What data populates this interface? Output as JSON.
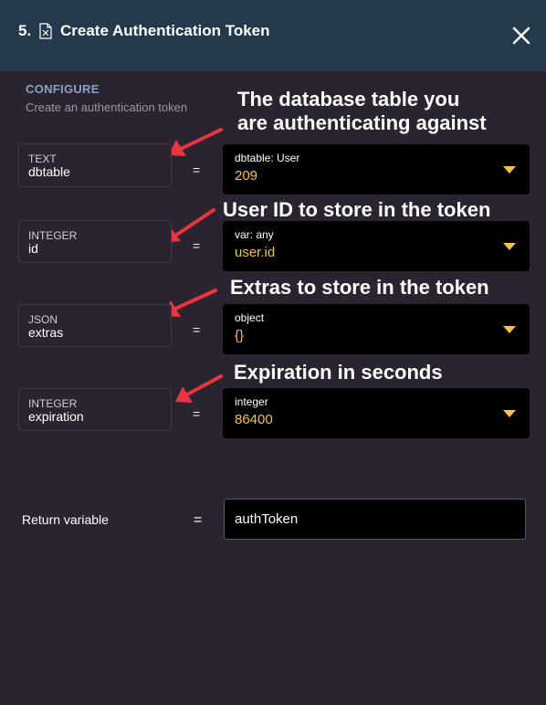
{
  "header": {
    "step": "5.",
    "title": "Create Authentication Token"
  },
  "section": {
    "title": "CONFIGURE",
    "subtitle": "Create an authentication token"
  },
  "params": [
    {
      "type": "TEXT",
      "name": "dbtable",
      "equals": "=",
      "value_type": "dbtable: User",
      "value": "209",
      "annotation": [
        "The database table you",
        "are authenticating against"
      ]
    },
    {
      "type": "INTEGER",
      "name": "id",
      "equals": "=",
      "value_type": "var: any",
      "value": "user.id",
      "annotation": [
        "User ID to store in the token"
      ]
    },
    {
      "type": "JSON",
      "name": "extras",
      "equals": "=",
      "value_type": "object",
      "value": "{}",
      "annotation": [
        "Extras to store in the token"
      ]
    },
    {
      "type": "INTEGER",
      "name": "expiration",
      "equals": "=",
      "value_type": "integer",
      "value": "86400",
      "annotation": [
        "Expiration in seconds"
      ]
    }
  ],
  "return": {
    "label": "Return variable",
    "equals": "=",
    "value": "authToken"
  },
  "colors": {
    "header_bg": "#24394c",
    "panel_bg": "#2a2330",
    "accent_value": "#f2c14e",
    "arrow": "#e8353f"
  }
}
